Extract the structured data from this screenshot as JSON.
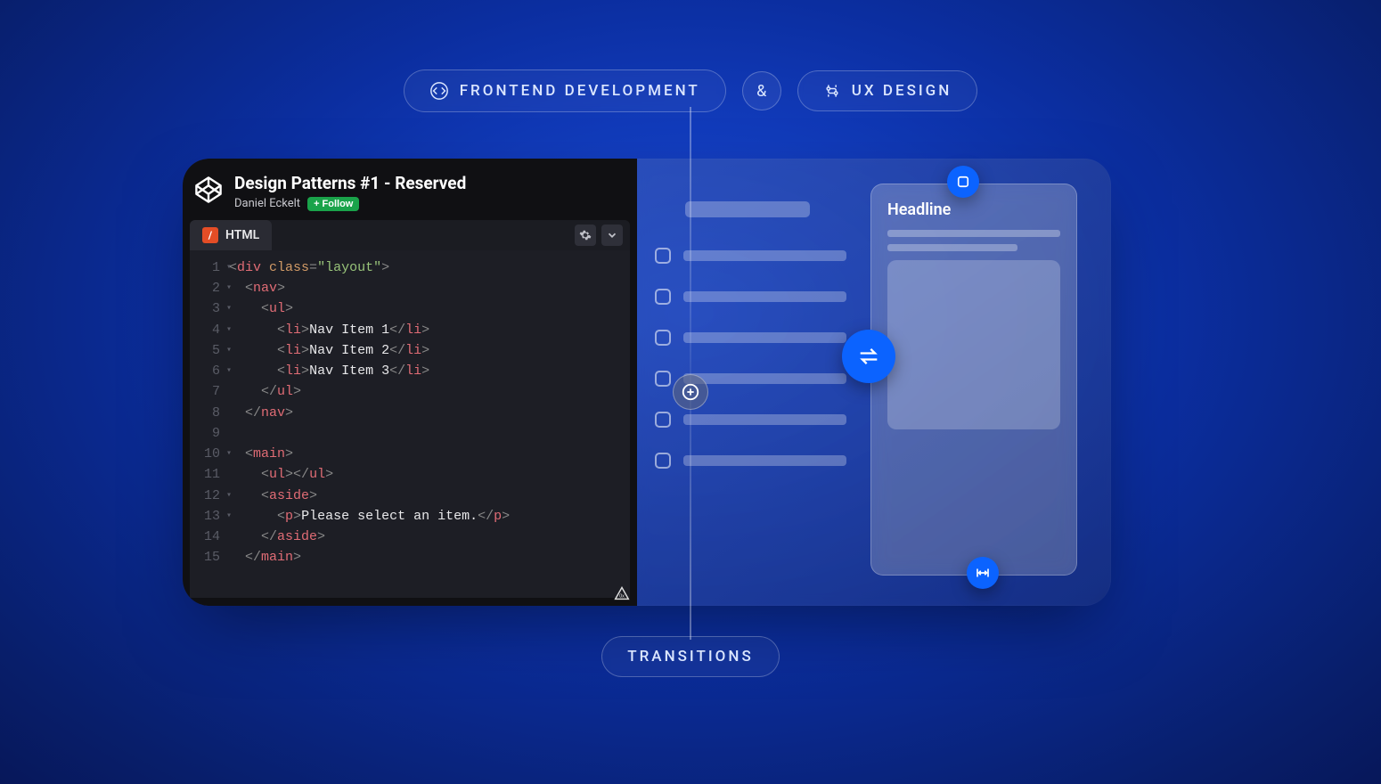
{
  "pills": {
    "left": "FRONTEND DEVELOPMENT",
    "amp": "&",
    "right": "UX DESIGN",
    "bottom": "TRANSITIONS"
  },
  "codepen": {
    "title": "Design Patterns #1 - Reserved",
    "author": "Daniel Eckelt",
    "follow_label": "Follow",
    "tab_label": "HTML"
  },
  "code": {
    "lines": [
      {
        "n": "1",
        "fold": true,
        "ind": 0,
        "seg": [
          [
            "punc",
            "<"
          ],
          [
            "tag",
            "div "
          ],
          [
            "attr",
            "class"
          ],
          [
            "punc",
            "="
          ],
          [
            "str",
            "\"layout\""
          ],
          [
            "punc",
            ">"
          ]
        ]
      },
      {
        "n": "2",
        "fold": true,
        "ind": 1,
        "seg": [
          [
            "punc",
            "<"
          ],
          [
            "tag",
            "nav"
          ],
          [
            "punc",
            ">"
          ]
        ]
      },
      {
        "n": "3",
        "fold": true,
        "ind": 2,
        "seg": [
          [
            "punc",
            "<"
          ],
          [
            "tag",
            "ul"
          ],
          [
            "punc",
            ">"
          ]
        ]
      },
      {
        "n": "4",
        "fold": true,
        "ind": 3,
        "seg": [
          [
            "punc",
            "<"
          ],
          [
            "tag",
            "li"
          ],
          [
            "punc",
            ">"
          ],
          [
            "txt",
            "Nav Item 1"
          ],
          [
            "punc",
            "</"
          ],
          [
            "tag",
            "li"
          ],
          [
            "punc",
            ">"
          ]
        ]
      },
      {
        "n": "5",
        "fold": true,
        "ind": 3,
        "seg": [
          [
            "punc",
            "<"
          ],
          [
            "tag",
            "li"
          ],
          [
            "punc",
            ">"
          ],
          [
            "txt",
            "Nav Item 2"
          ],
          [
            "punc",
            "</"
          ],
          [
            "tag",
            "li"
          ],
          [
            "punc",
            ">"
          ]
        ]
      },
      {
        "n": "6",
        "fold": true,
        "ind": 3,
        "seg": [
          [
            "punc",
            "<"
          ],
          [
            "tag",
            "li"
          ],
          [
            "punc",
            ">"
          ],
          [
            "txt",
            "Nav Item 3"
          ],
          [
            "punc",
            "</"
          ],
          [
            "tag",
            "li"
          ],
          [
            "punc",
            ">"
          ]
        ]
      },
      {
        "n": "7",
        "fold": false,
        "ind": 2,
        "seg": [
          [
            "punc",
            "</"
          ],
          [
            "tag",
            "ul"
          ],
          [
            "punc",
            ">"
          ]
        ]
      },
      {
        "n": "8",
        "fold": false,
        "ind": 1,
        "seg": [
          [
            "punc",
            "</"
          ],
          [
            "tag",
            "nav"
          ],
          [
            "punc",
            ">"
          ]
        ]
      },
      {
        "n": "9",
        "fold": false,
        "ind": 0,
        "seg": []
      },
      {
        "n": "10",
        "fold": true,
        "ind": 1,
        "seg": [
          [
            "punc",
            "<"
          ],
          [
            "tag",
            "main"
          ],
          [
            "punc",
            ">"
          ]
        ]
      },
      {
        "n": "11",
        "fold": false,
        "ind": 2,
        "seg": [
          [
            "punc",
            "<"
          ],
          [
            "tag",
            "ul"
          ],
          [
            "punc",
            "></"
          ],
          [
            "tag",
            "ul"
          ],
          [
            "punc",
            ">"
          ]
        ]
      },
      {
        "n": "12",
        "fold": true,
        "ind": 2,
        "seg": [
          [
            "punc",
            "<"
          ],
          [
            "tag",
            "aside"
          ],
          [
            "punc",
            ">"
          ]
        ]
      },
      {
        "n": "13",
        "fold": true,
        "ind": 3,
        "seg": [
          [
            "punc",
            "<"
          ],
          [
            "tag",
            "p"
          ],
          [
            "punc",
            ">"
          ],
          [
            "txt",
            "Please select an item."
          ],
          [
            "punc",
            "</"
          ],
          [
            "tag",
            "p"
          ],
          [
            "punc",
            ">"
          ]
        ]
      },
      {
        "n": "14",
        "fold": false,
        "ind": 2,
        "seg": [
          [
            "punc",
            "</"
          ],
          [
            "tag",
            "aside"
          ],
          [
            "punc",
            ">"
          ]
        ]
      },
      {
        "n": "15",
        "fold": false,
        "ind": 1,
        "seg": [
          [
            "punc",
            "</"
          ],
          [
            "tag",
            "main"
          ],
          [
            "punc",
            ">"
          ]
        ]
      }
    ]
  },
  "design": {
    "detail_headline": "Headline",
    "list_rows": 6
  }
}
